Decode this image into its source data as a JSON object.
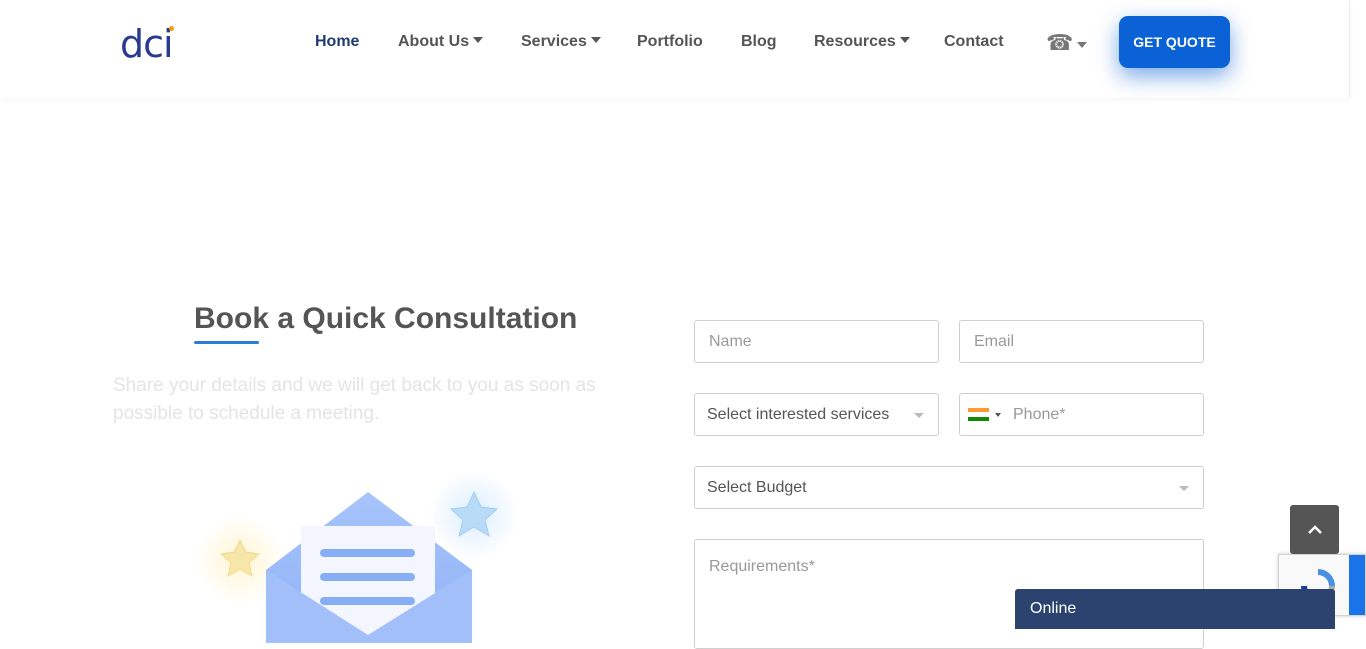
{
  "header": {
    "logo_text": "dc",
    "logo_i": "i",
    "nav": [
      {
        "label": "Home",
        "has_dropdown": false,
        "active": true
      },
      {
        "label": "About Us",
        "has_dropdown": true
      },
      {
        "label": "Services",
        "has_dropdown": true
      },
      {
        "label": "Portfolio",
        "has_dropdown": false
      },
      {
        "label": "Blog",
        "has_dropdown": false
      },
      {
        "label": "Resources",
        "has_dropdown": true
      },
      {
        "label": "Contact",
        "has_dropdown": false
      }
    ],
    "phone_icon": "☎",
    "cta_label": "GET QUOTE"
  },
  "consultation": {
    "title": "Book a Quick Consultation",
    "description": "Share your details and we will get back to you as soon as possible to schedule a meeting."
  },
  "form": {
    "name_placeholder": "Name",
    "email_placeholder": "Email",
    "services_select": "Select interested services",
    "phone_placeholder": "Phone*",
    "budget_select": "Select Budget",
    "requirements_placeholder": "Requirements*"
  },
  "widgets": {
    "chat_status": "Online",
    "back_to_top_icon": "chevron-up-icon"
  },
  "colors": {
    "brand_navy": "#2a3b8f",
    "cta_blue": "#0a62d6",
    "chat_bar": "#2c4370",
    "accent_orange": "#f39c12"
  }
}
